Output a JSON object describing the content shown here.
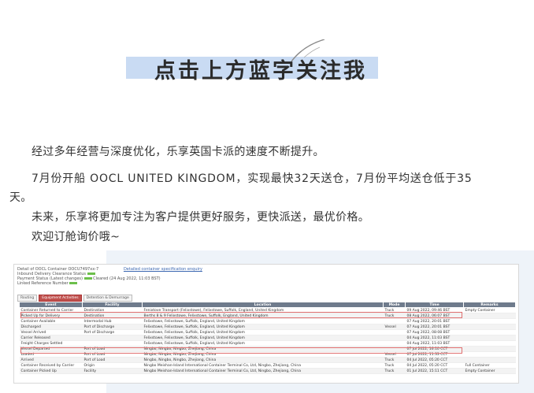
{
  "banner": {
    "title": "点击上方蓝字关注我"
  },
  "article": {
    "p1": "经过多年经营与深度优化，乐享英国卡派的速度不断提升。",
    "p2a": "7月份开船 OOCL UNITED KINGDOM，实现最快32天送仓，7月份平均送仓低于35",
    "p2b": "天。",
    "p3": "未来，乐享将更加专注为客户提供更好服务，更快派送，最优价格。",
    "p4": "欢迎订舱询价哦~"
  },
  "screenshot": {
    "header_line1": "Detail of OOCL Container OOCU7497xx-7",
    "header_link": "Detailed container specification enquiry",
    "header_line2": "Inbound Delivery Clearance Status",
    "header_line3": "Payment Status (Latest changes)",
    "status_value": "Cleared (24 Aug 2022, 11:03 BST)",
    "header_line4": "Linked Reference Number",
    "tabs": [
      "Routing",
      "Equipment Activities",
      "Detention & Demurrage"
    ],
    "columns": [
      "Event",
      "Facility",
      "Location",
      "Mode",
      "Time",
      "Remarks"
    ],
    "rows": [
      {
        "event": "Container Returned to Carrier",
        "facility": "Destination",
        "location": "Fenixtove Transport (Felixstowe), Felixstowe, Suffolk, England, United Kingdom",
        "mode": "Truck",
        "time": "09 Aug 2022, 09:46 BST",
        "remarks": "Empty Container"
      },
      {
        "event": "Picked Up for Delivery",
        "facility": "Destination",
        "location": "Berths 8 & 9 Felixstowe, Felixstowe, Suffolk, England, United Kingdom",
        "mode": "Truck",
        "time": "08 Aug 2022, 06:07 BST",
        "remarks": ""
      },
      {
        "event": "Container Available",
        "facility": "Intermodal Hub",
        "location": "Felixstowe, Felixstowe, Suffolk, England, United Kingdom",
        "mode": "",
        "time": "07 Aug 2022, 20:01 BST",
        "remarks": ""
      },
      {
        "event": "Discharged",
        "facility": "Port of Discharge",
        "location": "Felixstowe, Felixstowe, Suffolk, England, United Kingdom",
        "mode": "Vessel",
        "time": "07 Aug 2022, 20:01 BST",
        "remarks": ""
      },
      {
        "event": "Vessel Arrived",
        "facility": "Port of Discharge",
        "location": "Felixstowe, Felixstowe, Suffolk, England, United Kingdom",
        "mode": "",
        "time": "07 Aug 2022, 08:08 BST",
        "remarks": ""
      },
      {
        "event": "Carrier Released",
        "facility": "",
        "location": "Felixstowe, Felixstowe, Suffolk, England, United Kingdom",
        "mode": "",
        "time": "04 Aug 2022, 11:03 BST",
        "remarks": ""
      },
      {
        "event": "Freight Charges Settled",
        "facility": "",
        "location": "Felixstowe, Felixstowe, Suffolk, England, United Kingdom",
        "mode": "",
        "time": "04 Aug 2022, 11:03 BST",
        "remarks": ""
      },
      {
        "event": "Vessel Departed",
        "facility": "Port of Load",
        "location": "Ningbo, Ningbo, Ningbo, Zhejiang, China",
        "mode": "",
        "time": "07 Jul 2022, 16:10 CCT",
        "remarks": ""
      },
      {
        "event": "Loaded",
        "facility": "Port of Load",
        "location": "Ningbo, Ningbo, Ningbo, Zhejiang, China",
        "mode": "Vessel",
        "time": "07 Jul 2022, 11:33 CCT",
        "remarks": ""
      },
      {
        "event": "Arrived",
        "facility": "Port of Load",
        "location": "Ningbo, Ningbo, Ningbo, Zhejiang, China",
        "mode": "Truck",
        "time": "04 Jul 2022, 05:20 CCT",
        "remarks": ""
      },
      {
        "event": "Container Received by Carrier",
        "facility": "Origin",
        "location": "Ningbo Meishan-Island International Container Terminal Co, Ltd, Ningbo, Zhejiang, China",
        "mode": "Truck",
        "time": "04 Jul 2022, 05:20 CCT",
        "remarks": "Full Container"
      },
      {
        "event": "Container Picked Up",
        "facility": "Facility",
        "location": "Ningbo Meishan-Island International Container Terminal Co, Ltd, Ningbo, Zhejiang, China",
        "mode": "Truck",
        "time": "01 Jul 2022, 15:11 CCT",
        "remarks": "Empty Container"
      }
    ]
  }
}
